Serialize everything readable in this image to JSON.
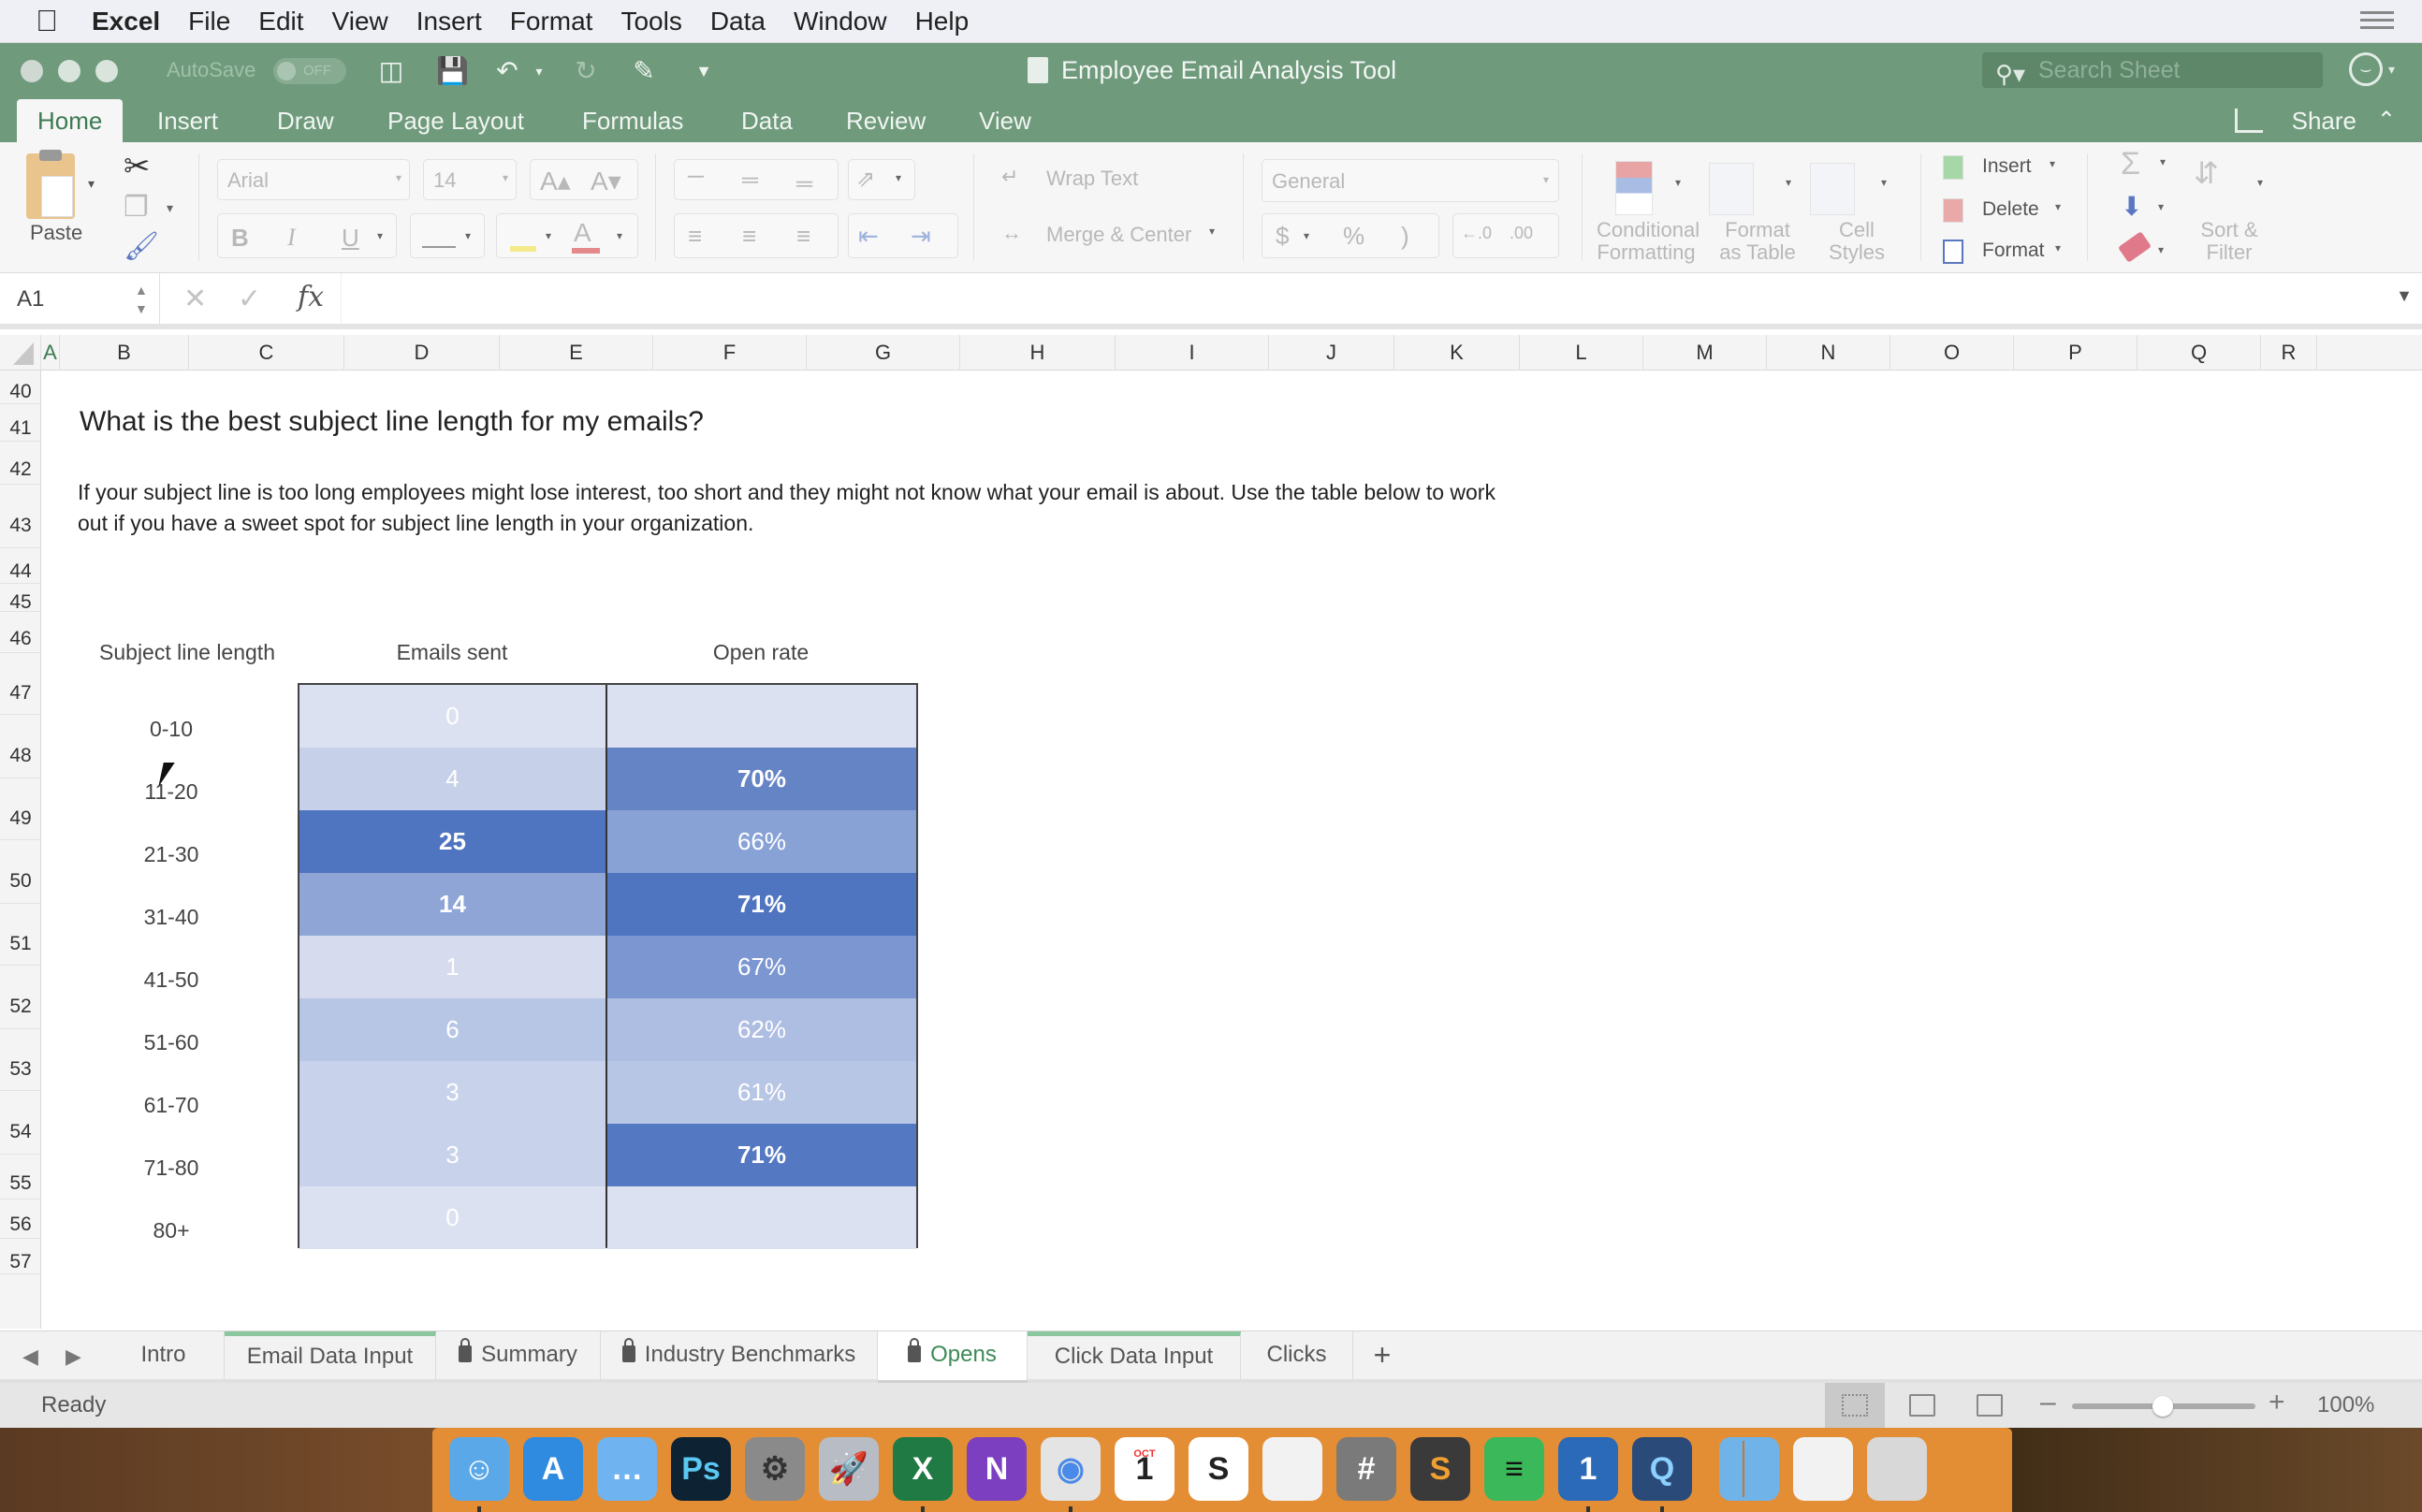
{
  "menubar": {
    "apple": "",
    "items": [
      "Excel",
      "File",
      "Edit",
      "View",
      "Insert",
      "Format",
      "Tools",
      "Data",
      "Window",
      "Help"
    ]
  },
  "titlebar": {
    "autosave_label": "AutoSave",
    "autosave_state": "OFF",
    "document_title": "Employee Email Analysis Tool",
    "search_placeholder": "Search Sheet"
  },
  "ribbon_tabs": {
    "items": [
      "Home",
      "Insert",
      "Draw",
      "Page Layout",
      "Formulas",
      "Data",
      "Review",
      "View"
    ],
    "active": "Home",
    "share_label": "Share"
  },
  "ribbon": {
    "paste_label": "Paste",
    "font_name": "Arial",
    "font_size": "14",
    "bold": "B",
    "italic": "I",
    "underline": "U",
    "wrap_text": "Wrap Text",
    "merge_center": "Merge & Center",
    "number_format": "General",
    "currency": "$",
    "percent": "%",
    "comma": ")",
    "conditional_formatting": [
      "Conditional",
      "Formatting"
    ],
    "format_as_table": [
      "Format",
      "as Table"
    ],
    "cell_styles": [
      "Cell",
      "Styles"
    ],
    "insert": "Insert",
    "delete": "Delete",
    "format": "Format",
    "sort_filter": [
      "Sort &",
      "Filter"
    ]
  },
  "formula_bar": {
    "name_box": "A1",
    "formula": ""
  },
  "columns": [
    "A",
    "B",
    "C",
    "D",
    "E",
    "F",
    "G",
    "H",
    "I",
    "J",
    "K",
    "L",
    "M",
    "N",
    "O",
    "P",
    "Q",
    "R"
  ],
  "selected_column": "A",
  "rows": [
    "40",
    "41",
    "42",
    "43",
    "44",
    "45",
    "46",
    "47",
    "48",
    "49",
    "50",
    "51",
    "52",
    "53",
    "54",
    "55",
    "56",
    "57"
  ],
  "sheet": {
    "heading": "What is the best subject line length for my emails?",
    "description": "If your subject line is too long employees might lose interest, too short and they might not know what your email is about. Use the table below to work out if you have a sweet spot for subject line length in your organization.",
    "table": {
      "headers": [
        "Subject line length",
        "Emails sent",
        "Open rate"
      ],
      "rows": [
        {
          "length": "0-10",
          "sent": "0",
          "open_rate": ""
        },
        {
          "length": "11-20",
          "sent": "4",
          "open_rate": "70%"
        },
        {
          "length": "21-30",
          "sent": "25",
          "open_rate": "66%"
        },
        {
          "length": "31-40",
          "sent": "14",
          "open_rate": "71%"
        },
        {
          "length": "41-50",
          "sent": "1",
          "open_rate": "67%"
        },
        {
          "length": "51-60",
          "sent": "6",
          "open_rate": "62%"
        },
        {
          "length": "61-70",
          "sent": "3",
          "open_rate": "61%"
        },
        {
          "length": "71-80",
          "sent": "3",
          "open_rate": "71%"
        },
        {
          "length": "80+",
          "sent": "0",
          "open_rate": ""
        }
      ],
      "sent_colors": [
        "#dbe1f0",
        "#c6d0e9",
        "#4f74c0",
        "#8ea5d6",
        "#d6dcee",
        "#b8c6e5",
        "#c8d2eb",
        "#c8d2eb",
        "#dbe1f0"
      ],
      "rate_colors": [
        "#dbe1f0",
        "#6584c6",
        "#88a2d6",
        "#4f74c0",
        "#7b96d0",
        "#aebde2",
        "#b8c6e5",
        "#5478c2",
        "#dbe1f0"
      ]
    }
  },
  "sheet_tabs": {
    "items": [
      {
        "label": "Intro",
        "locked": false,
        "green": false
      },
      {
        "label": "Email Data Input",
        "locked": false,
        "green": true
      },
      {
        "label": "Summary",
        "locked": true,
        "green": false
      },
      {
        "label": "Industry Benchmarks",
        "locked": true,
        "green": false
      },
      {
        "label": "Opens",
        "locked": true,
        "green": false,
        "active": true
      },
      {
        "label": "Click Data Input",
        "locked": false,
        "green": true
      },
      {
        "label": "Clicks",
        "locked": false,
        "green": false
      }
    ],
    "add_label": "+"
  },
  "status_bar": {
    "status": "Ready",
    "zoom": "100%",
    "zoom_percent": 100
  },
  "dock": {
    "apps": [
      "Finder",
      "App Store",
      "Messages",
      "Photoshop",
      "System Preferences",
      "Launchpad",
      "Excel",
      "OneNote",
      "Chrome",
      "Calendar",
      "Slack",
      "TextEdit",
      "Calculator",
      "Sublime Text",
      "Spotify",
      "1Password",
      "QuickTime",
      "Folder",
      "Archive",
      "Trash"
    ],
    "calendar_month": "OCT",
    "calendar_day": "1"
  },
  "colors": {
    "excel_green": "#6f9a7c",
    "accent_blue": "#4f74c0"
  }
}
